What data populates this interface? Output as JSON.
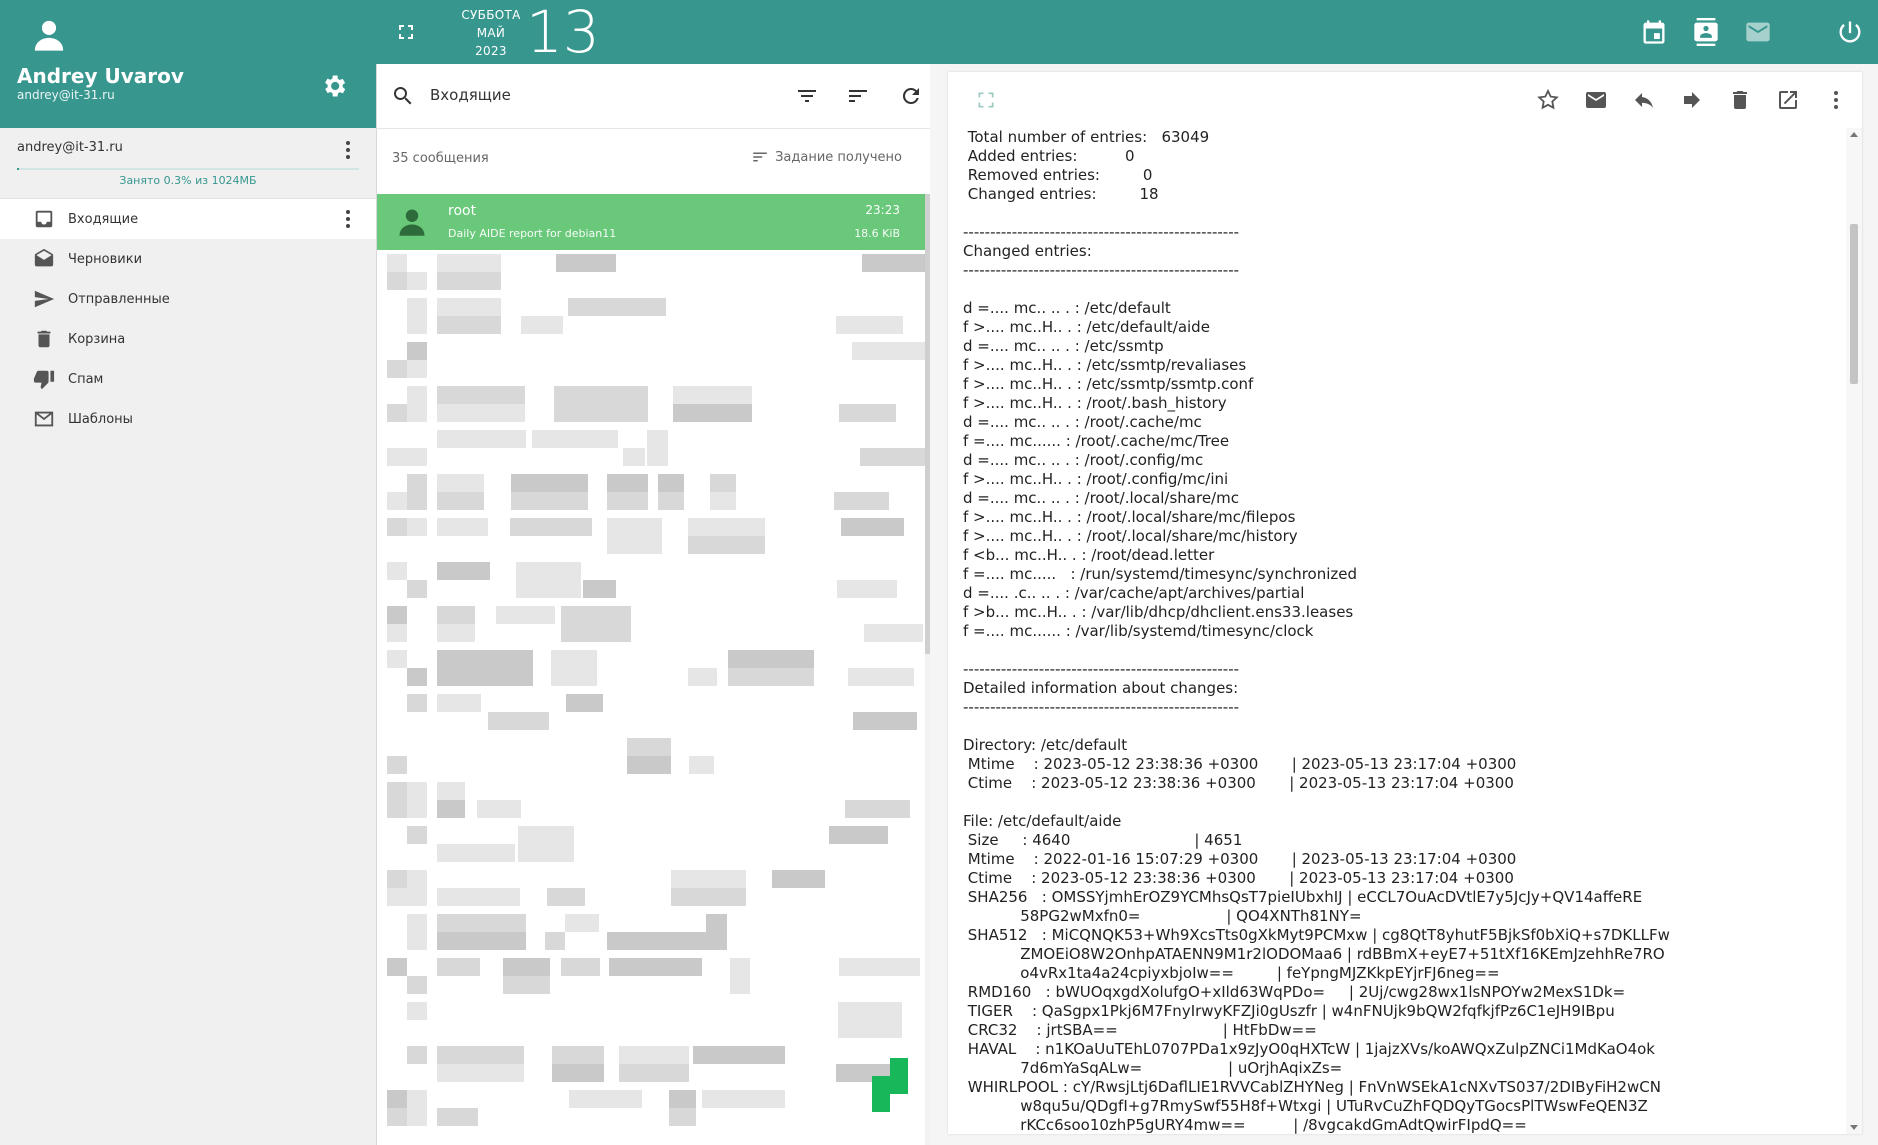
{
  "app": {
    "accent": "#37978f",
    "selected_row_color": "#69c87a"
  },
  "sidebar": {
    "user_name": "Andrey Uvarov",
    "user_email": "andrey@it-31.ru",
    "account_email": "andrey@it-31.ru",
    "quota_text": "Занято 0.3% из 1024МБ",
    "quota_fraction": 0.003,
    "folders": [
      {
        "label": "Входящие",
        "icon": "inbox-icon",
        "active": true
      },
      {
        "label": "Черновики",
        "icon": "drafts-icon"
      },
      {
        "label": "Отправленные",
        "icon": "send-icon"
      },
      {
        "label": "Корзина",
        "icon": "trash-icon"
      },
      {
        "label": "Спам",
        "icon": "thumb-down-icon"
      },
      {
        "label": "Шаблоны",
        "icon": "mail-template-icon"
      }
    ]
  },
  "topbar": {
    "weekday": "СУББОТА",
    "month": "МАЙ",
    "year": "2023",
    "day": "13",
    "icons": [
      "calendar-icon",
      "contacts-icon",
      "mail-icon",
      "power-icon"
    ]
  },
  "list": {
    "folder_title": "Входящие",
    "count_text": "35 сообщения",
    "sort_label": "Задание получено",
    "selected_message": {
      "from": "root",
      "subject": "Daily AIDE report for debian11",
      "time": "23:23",
      "size": "18.6 KiB"
    }
  },
  "viewer": {
    "toolbar_icons": [
      "star-icon",
      "mark-unread-icon",
      "reply-icon",
      "forward-icon",
      "delete-icon",
      "open-new-window-icon",
      "more-vert-icon"
    ],
    "body_lines": [
      " Total number of entries:   63049",
      " Added entries:          0",
      " Removed entries:         0",
      " Changed entries:         18",
      "",
      "---------------------------------------------------",
      "Changed entries:",
      "---------------------------------------------------",
      "",
      "d =.... mc.. .. . : /etc/default",
      "f >.... mc..H.. . : /etc/default/aide",
      "d =.... mc.. .. . : /etc/ssmtp",
      "f >.... mc..H.. . : /etc/ssmtp/revaliases",
      "f >.... mc..H.. . : /etc/ssmtp/ssmtp.conf",
      "f >.... mc..H.. . : /root/.bash_history",
      "d =.... mc.. .. . : /root/.cache/mc",
      "f =.... mc...... : /root/.cache/mc/Tree",
      "d =.... mc.. .. . : /root/.config/mc",
      "f >.... mc..H.. . : /root/.config/mc/ini",
      "d =.... mc.. .. . : /root/.local/share/mc",
      "f >.... mc..H.. . : /root/.local/share/mc/filepos",
      "f >.... mc..H.. . : /root/.local/share/mc/history",
      "f <b... mc..H.. . : /root/dead.letter",
      "f =.... mc.....   : /run/systemd/timesync/synchronized",
      "d =.... .c.. .. . : /var/cache/apt/archives/partial",
      "f >b... mc..H.. . : /var/lib/dhcp/dhclient.ens33.leases",
      "f =.... mc...... : /var/lib/systemd/timesync/clock",
      "",
      "---------------------------------------------------",
      "Detailed information about changes:",
      "---------------------------------------------------",
      "",
      "Directory: /etc/default",
      " Mtime    : 2023-05-12 23:38:36 +0300       | 2023-05-13 23:17:04 +0300",
      " Ctime    : 2023-05-12 23:38:36 +0300       | 2023-05-13 23:17:04 +0300",
      "",
      "File: /etc/default/aide",
      " Size     : 4640                          | 4651",
      " Mtime    : 2022-01-16 15:07:29 +0300       | 2023-05-13 23:17:04 +0300",
      " Ctime    : 2023-05-12 23:38:36 +0300       | 2023-05-13 23:17:04 +0300",
      " SHA256   : OMSSYjmhErOZ9YCMhsQsT7pieIUbxhIJ | eCCL7OuAcDVtlE7y5JcJy+QV14affeRE",
      "            58PG2wMxfn0=                  | QO4XNTh81NY=",
      " SHA512   : MiCQNQK53+Wh9XcsTts0gXkMyt9PCMxw | cg8QtT8yhutF5BjkSf0bXiQ+s7DKLLFw",
      "            ZMOEiO8W2OnhpATAENN9M1r2lODOMaa6 | rdBBmX+eyE7+51tXf16KEmJzehhRe7RO",
      "            o4vRx1ta4a24cpiyxbjoIw==         | feYpngMJZKkpEYjrFJ6neg==",
      " RMD160   : bWUOqxgdXolufgO+xIld63WqPDo=     | 2Uj/cwg28wx1lsNPOYw2MexS1Dk=",
      " TIGER    : QaSgpx1Pkj6M7FnyIrwyKFZJi0gUszfr | w4nFNUjk9bQW2fqfkjfPz6C1eJH9IBpu",
      " CRC32    : jrtSBA==                      | HtFbDw==",
      " HAVAL    : n1KOaUuTEhL0707PDa1x9zJyO0qHXTcW | 1jajzXVs/koAWQxZulpZNCi1MdKaO4ok",
      "            7d6mYaSqALw=                  | uOrjhAqixZs=",
      " WHIRLPOOL : cY/RwsjLtj6DaflLIE1RVVCablZHYNeg | FnVnWSEkA1cNXvTS037/2DIByFiH2wCN",
      "            w8qu5u/QDgfI+g7RmySwf55H8f+Wtxgi | UTuRvCuZhFQDQyTGocsPlTWswFeQEN3Z",
      "            rKCc6soo10zhP5gURY4mw==          | /8vgcakdGmAdtQwirFIpdQ=="
    ]
  }
}
